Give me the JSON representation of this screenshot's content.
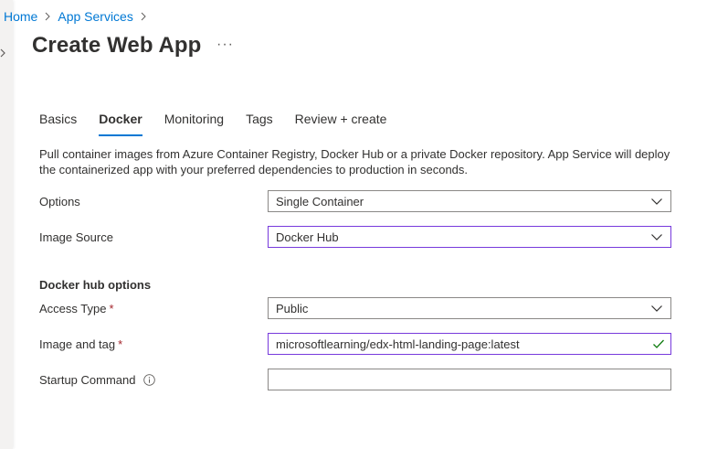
{
  "breadcrumb": {
    "items": [
      {
        "label": "Home"
      },
      {
        "label": "App Services"
      }
    ]
  },
  "page": {
    "title": "Create Web App",
    "more_label": "···"
  },
  "tabs": [
    {
      "label": "Basics",
      "active": false
    },
    {
      "label": "Docker",
      "active": true
    },
    {
      "label": "Monitoring",
      "active": false
    },
    {
      "label": "Tags",
      "active": false
    },
    {
      "label": "Review + create",
      "active": false
    }
  ],
  "description": {
    "line1": "Pull container images from Azure Container Registry, Docker Hub or a private Docker repository. App Service will deploy",
    "line2": "the containerized app with your preferred dependencies to production in seconds."
  },
  "form": {
    "options": {
      "label": "Options",
      "value": "Single Container"
    },
    "image_source": {
      "label": "Image Source",
      "value": "Docker Hub"
    },
    "section_title": "Docker hub options",
    "access_type": {
      "label": "Access Type",
      "required_mark": "*",
      "value": "Public"
    },
    "image_tag": {
      "label": "Image and tag",
      "required_mark": "*",
      "value": "microsoftlearning/edx-html-landing-page:latest"
    },
    "startup_command": {
      "label": "Startup Command",
      "value": ""
    }
  },
  "colors": {
    "accent": "#0078d4",
    "focus_border": "#773adc",
    "valid_check": "#107c10",
    "required": "#a4262c"
  },
  "icons": {
    "breadcrumb_separator": "chevron-right-icon",
    "dropdown": "chevron-down-icon",
    "valid": "checkmark-icon",
    "info": "info-icon",
    "rail": "chevron-right-icon"
  }
}
